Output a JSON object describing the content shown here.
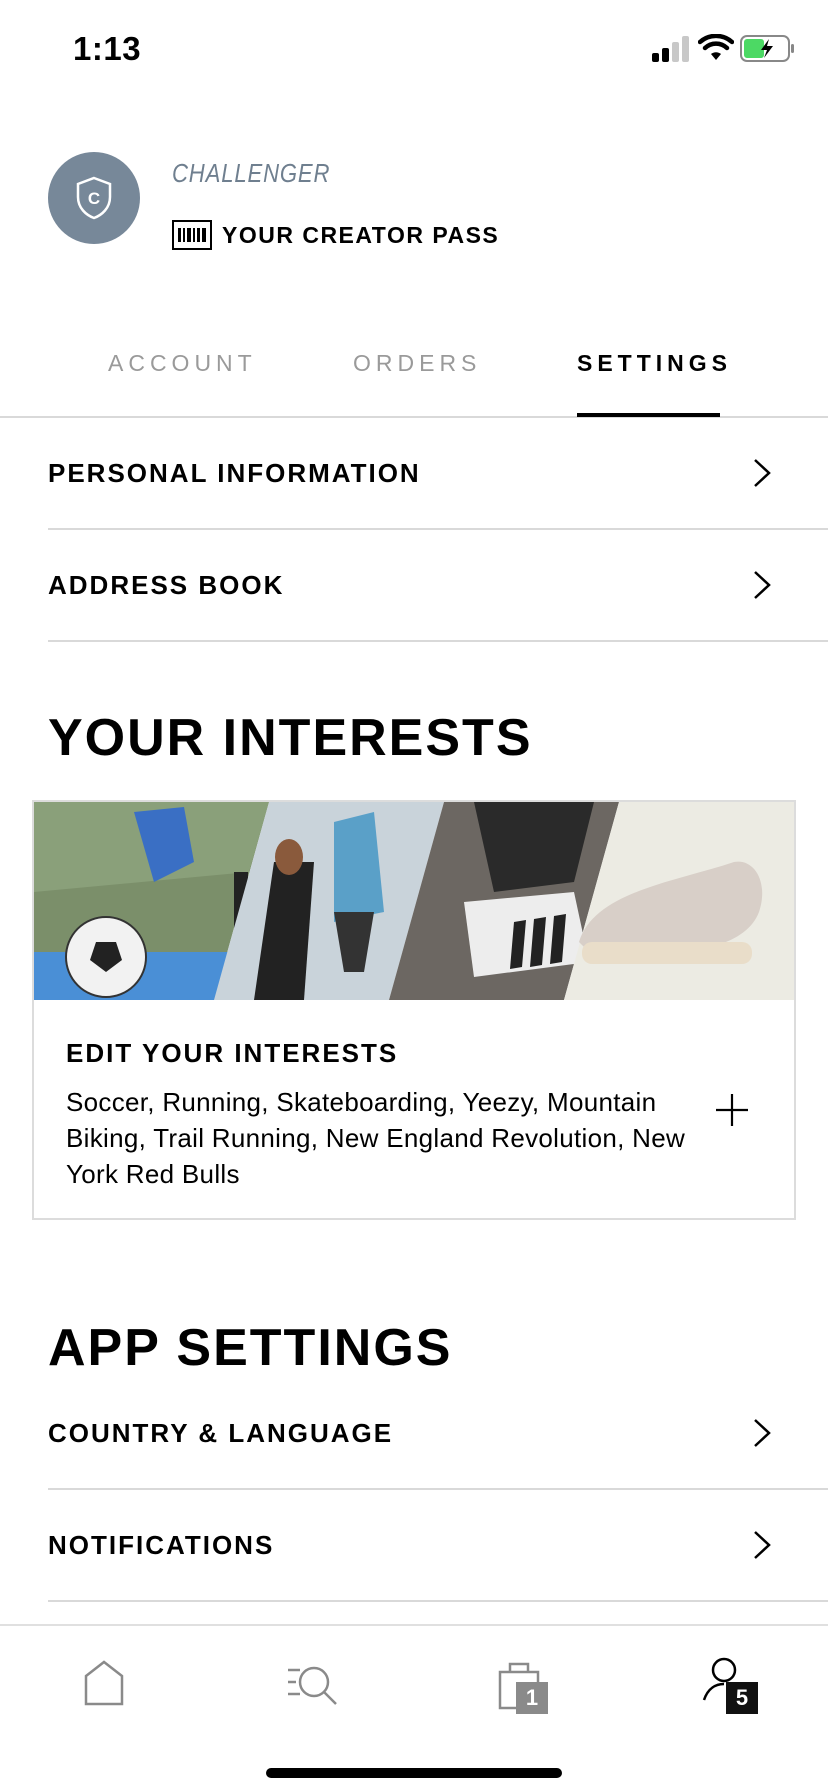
{
  "status_bar": {
    "time": "1:13"
  },
  "profile": {
    "avatar_letter": "C",
    "tier": "CHALLENGER",
    "creator_pass_label": "YOUR CREATOR PASS"
  },
  "tabs": [
    {
      "label": "ACCOUNT",
      "active": false
    },
    {
      "label": "ORDERS",
      "active": false
    },
    {
      "label": "SETTINGS",
      "active": true
    }
  ],
  "settings_rows": [
    {
      "label": "PERSONAL INFORMATION"
    },
    {
      "label": "ADDRESS BOOK"
    }
  ],
  "interests": {
    "section_title": "YOUR INTERESTS",
    "card_title": "EDIT YOUR INTERESTS",
    "card_body": "Soccer, Running, Skateboarding, Yeezy, Mountain Biking, Trail Running, New England Revolution, New York Red Bulls"
  },
  "app_settings": {
    "section_title": "APP SETTINGS",
    "rows": [
      {
        "label": "COUNTRY & LANGUAGE"
      },
      {
        "label": "NOTIFICATIONS"
      }
    ]
  },
  "bottom_nav": {
    "items": [
      {
        "icon": "home-icon"
      },
      {
        "icon": "search-icon"
      },
      {
        "icon": "bag-icon",
        "badge": "1"
      },
      {
        "icon": "profile-icon",
        "badge": "5"
      }
    ]
  },
  "colors": {
    "avatar_bg": "#778899",
    "tier_text": "#6f7f8f",
    "inactive_tab": "#9a9a9a",
    "divider": "#d9d9d9"
  }
}
